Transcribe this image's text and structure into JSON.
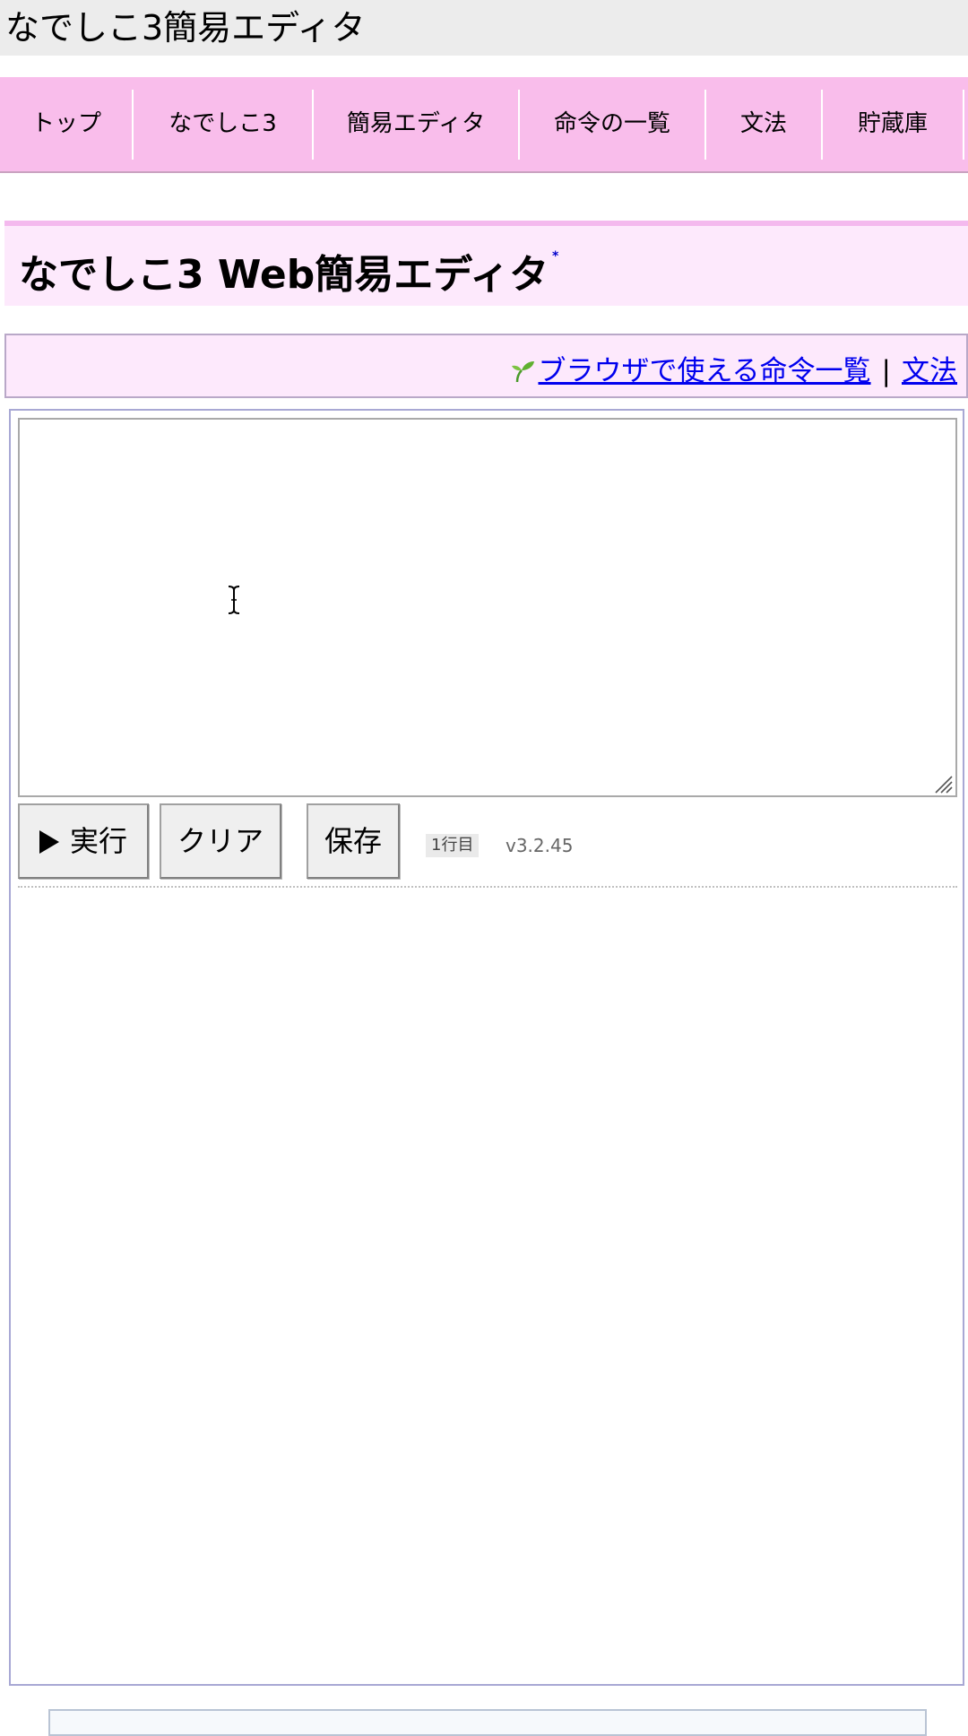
{
  "window": {
    "title": "なでしこ3簡易エディタ"
  },
  "nav": {
    "items": [
      {
        "label": "トップ"
      },
      {
        "label": "なでしこ3"
      },
      {
        "label": "簡易エディタ"
      },
      {
        "label": "命令の一覧"
      },
      {
        "label": "文法"
      },
      {
        "label": "貯蔵庫"
      }
    ]
  },
  "page": {
    "title": "なでしこ3 Web簡易エディタ",
    "title_mark": "*"
  },
  "links": {
    "icon": "sprout-icon",
    "commands_label": "ブラウザで使える命令一覧",
    "separator": "|",
    "grammar_label": "文法"
  },
  "editor": {
    "code": "",
    "run_label": "実行",
    "clear_label": "クリア",
    "save_label": "保存",
    "line_indicator": "1行目",
    "version": "v3.2.45"
  },
  "colors": {
    "nav_background": "#f9bdeb",
    "title_background": "#fde9fc",
    "link": "#0000ee"
  }
}
